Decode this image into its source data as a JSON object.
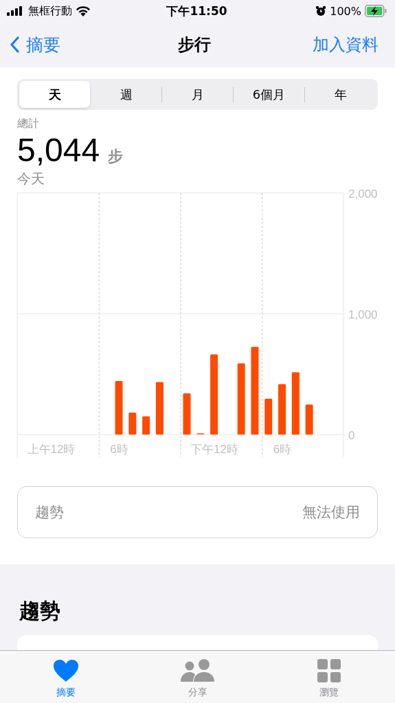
{
  "status_bar": {
    "carrier": "無框行動",
    "time": "下午11:50",
    "battery": "100%",
    "charging": true
  },
  "nav": {
    "back": "摘要",
    "title": "步行",
    "action": "加入資料"
  },
  "segments": [
    {
      "label": "天",
      "selected": true
    },
    {
      "label": "週",
      "selected": false
    },
    {
      "label": "月",
      "selected": false
    },
    {
      "label": "6個月",
      "selected": false
    },
    {
      "label": "年",
      "selected": false
    }
  ],
  "summary": {
    "label": "總計",
    "value": "5,044",
    "unit": "步",
    "period": "今天"
  },
  "chart_data": {
    "type": "bar",
    "categories": [
      null,
      null,
      "上午12時",
      null,
      null,
      null,
      null,
      "6時",
      null,
      null,
      null,
      null,
      null,
      null,
      "下午12時",
      null,
      null,
      null,
      null,
      "6時",
      null,
      null,
      null,
      null
    ],
    "series": [
      {
        "color": "#ff4a00",
        "values": [
          null,
          null,
          null,
          null,
          null,
          null,
          null,
          443,
          182,
          151,
          435,
          null,
          341,
          2,
          663,
          null,
          590,
          726,
          297,
          418,
          515,
          249,
          null,
          null
        ]
      }
    ],
    "ylim": [
      0,
      2000
    ],
    "ref_lines": [
      {
        "axis": "y",
        "value": 1000
      }
    ],
    "yticks": [
      {
        "value": 0,
        "label": "0"
      },
      {
        "value": 1000,
        "label": "1,000"
      },
      {
        "value": 2000,
        "label": "2,000"
      }
    ]
  },
  "trend_row": {
    "label": "趨勢",
    "value": "無法使用"
  },
  "section_title": "趨勢",
  "tab_bar": [
    {
      "label": "摘要",
      "selected": true
    },
    {
      "label": "分享",
      "selected": false
    },
    {
      "label": "瀏覽",
      "selected": false
    }
  ]
}
